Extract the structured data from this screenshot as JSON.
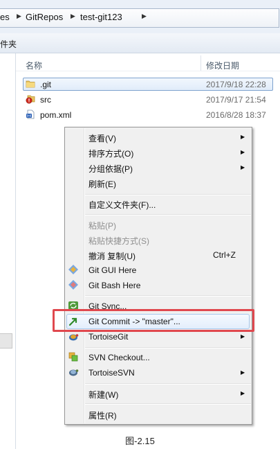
{
  "address": {
    "crumbs": [
      "es",
      "GitRepos",
      "test-git123"
    ]
  },
  "toolbar": {
    "partial_label": "件夹"
  },
  "columns": {
    "name": "名称",
    "modified": "修改日期"
  },
  "files": [
    {
      "name": ".git",
      "modified": "2017/9/18 22:28",
      "icon": "folder-icon"
    },
    {
      "name": "src",
      "modified": "2017/9/17 21:54",
      "icon": "folder-conflict-icon"
    },
    {
      "name": "pom.xml",
      "modified": "2016/8/28 18:37",
      "icon": "xml-file-icon"
    }
  ],
  "menu": {
    "view": "查看(V)",
    "sort": "排序方式(O)",
    "group": "分组依据(P)",
    "refresh": "刷新(E)",
    "customize": "自定义文件夹(F)...",
    "paste": "粘贴(P)",
    "paste_shortcut": "粘贴快捷方式(S)",
    "undo_copy": "撤消 复制(U)",
    "undo_shortcut": "Ctrl+Z",
    "git_gui": "Git GUI Here",
    "git_bash": "Git Bash Here",
    "git_sync": "Git Sync...",
    "git_commit": "Git Commit -> \"master\"...",
    "tortoisegit": "TortoiseGit",
    "svn_checkout": "SVN Checkout...",
    "tortoisesvn": "TortoiseSVN",
    "new": "新建(W)",
    "properties": "属性(R)"
  },
  "caption": "图-2.15",
  "colors": {
    "highlight": "#e0484e",
    "selection": "#7da2ce"
  }
}
